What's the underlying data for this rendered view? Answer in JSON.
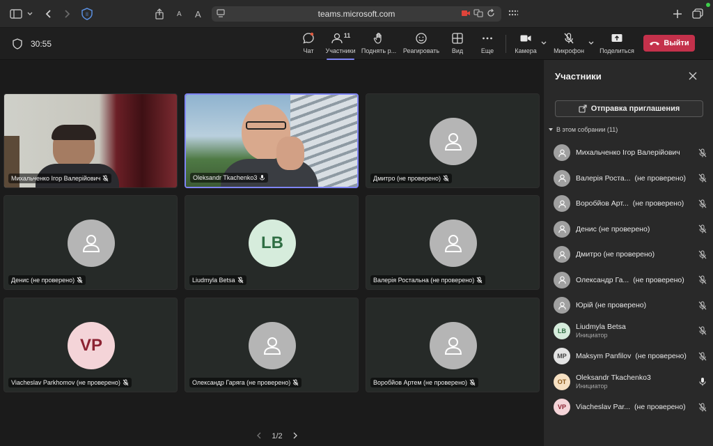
{
  "browser": {
    "url": "teams.microsoft.com",
    "icons": [
      "sidebar-icon",
      "chevron-down-icon",
      "back-icon",
      "forward-icon",
      "shield-icon",
      "share-icon",
      "text-small-icon",
      "text-large-icon",
      "reader-icon",
      "camera-active-icon",
      "translate-icon",
      "reload-icon",
      "grid-icon",
      "plus-icon",
      "tabs-icon"
    ]
  },
  "toolbar": {
    "timer": "30:55",
    "buttons": [
      {
        "label": "Чат",
        "icon": "chat-icon"
      },
      {
        "label": "Участники",
        "icon": "people-icon",
        "count": "11"
      },
      {
        "label": "Поднять р...",
        "icon": "raise-hand-icon"
      },
      {
        "label": "Реагировать",
        "icon": "emoji-icon"
      },
      {
        "label": "Вид",
        "icon": "grid-view-icon"
      },
      {
        "label": "Еще",
        "icon": "more-icon"
      },
      {
        "label": "Камера",
        "icon": "camera-icon"
      },
      {
        "label": "Микрофон",
        "icon": "mic-off-icon"
      },
      {
        "label": "Поделиться",
        "icon": "share-screen-icon"
      }
    ],
    "leave_label": "Выйти",
    "leave_color": "#c4314b"
  },
  "tiles": [
    {
      "name": "Михальченко Ігор Валерійович",
      "type": "video"
    },
    {
      "name": "Oleksandr Tkachenko3",
      "type": "video"
    },
    {
      "name": "Дмитро (не проверено)",
      "type": "person"
    },
    {
      "name": "Денис (не проверено)",
      "type": "person"
    },
    {
      "name": "Liudmyla Betsa",
      "type": "initials",
      "initials": "LB",
      "bg": "#d6ecdc",
      "fg": "#2f6e43"
    },
    {
      "name": "Валерія Ростальна (не проверено)",
      "type": "person"
    },
    {
      "name": "Viacheslav Parkhomov (не проверено)",
      "type": "initials",
      "initials": "VP",
      "bg": "#f4d4d8",
      "fg": "#8c2232"
    },
    {
      "name": "Олександр Гаряга (не проверено)",
      "type": "person"
    },
    {
      "name": "Воробйов Артем (не проверено)",
      "type": "person"
    }
  ],
  "pager": {
    "label": "1/2"
  },
  "panel": {
    "title": "Участники",
    "invite_label": "Отправка приглашения",
    "section_label": "В этом собрании (11)",
    "participants": [
      {
        "name": "Михальченко Ігор Валерійович",
        "suffix": "",
        "role": "",
        "avatar": "person",
        "mic": "off"
      },
      {
        "name": "Валерія Роста...",
        "suffix": "(не проверено)",
        "role": "",
        "avatar": "person",
        "mic": "off"
      },
      {
        "name": "Воробйов Арт...",
        "suffix": "(не проверено)",
        "role": "",
        "avatar": "person",
        "mic": "off"
      },
      {
        "name": "Денис (не проверено)",
        "suffix": "",
        "role": "",
        "avatar": "person",
        "mic": "off"
      },
      {
        "name": "Дмитро (не проверено)",
        "suffix": "",
        "role": "",
        "avatar": "person",
        "mic": "off"
      },
      {
        "name": "Олександр Га...",
        "suffix": "(не проверено)",
        "role": "",
        "avatar": "person",
        "mic": "off"
      },
      {
        "name": "Юрій (не проверено)",
        "suffix": "",
        "role": "",
        "avatar": "person",
        "mic": "off"
      },
      {
        "name": "Liudmyla Betsa",
        "suffix": "",
        "role": "Инициатор",
        "avatar": "LB",
        "bg": "#d6ecdc",
        "fg": "#2f6e43",
        "mic": "off"
      },
      {
        "name": "Maksym Panfilov",
        "suffix": "(не проверено)",
        "role": "",
        "avatar": "MP",
        "bg": "#e3e3e3",
        "fg": "#444444",
        "mic": "off"
      },
      {
        "name": "Oleksandr Tkachenko3",
        "suffix": "",
        "role": "Инициатор",
        "avatar": "OT",
        "bg": "#f6e0c2",
        "fg": "#8a5a1c",
        "mic": "on"
      },
      {
        "name": "Viacheslav Par...",
        "suffix": "(не проверено)",
        "role": "",
        "avatar": "VP",
        "bg": "#f4d4d8",
        "fg": "#8c2232",
        "mic": "off"
      }
    ]
  }
}
